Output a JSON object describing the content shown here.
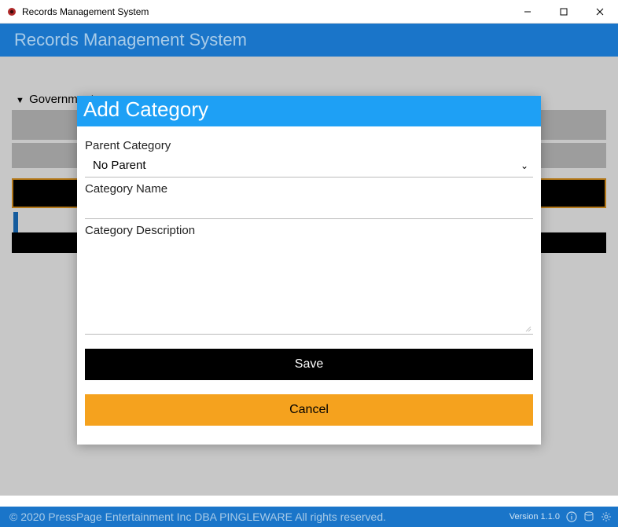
{
  "titlebar": {
    "title": "Records Management System"
  },
  "header": {
    "title": "Records Management System"
  },
  "tree": {
    "root_label": "Government"
  },
  "modal": {
    "title": "Add Category",
    "parent_label": "Parent Category",
    "parent_value": "No Parent",
    "name_label": "Category Name",
    "name_value": "",
    "desc_label": "Category Description",
    "desc_value": "",
    "save_label": "Save",
    "cancel_label": "Cancel"
  },
  "footer": {
    "copyright": "© 2020 PressPage Entertainment Inc DBA PINGLEWARE  All rights reserved.",
    "version": "Version 1.1.0"
  }
}
